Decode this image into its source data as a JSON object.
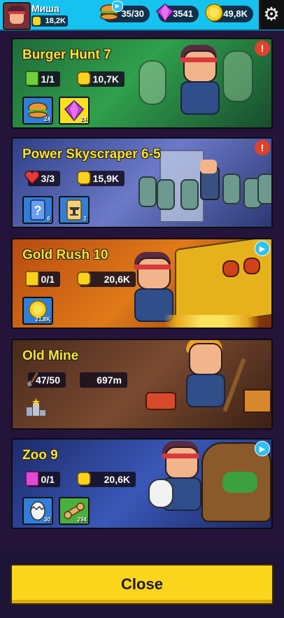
{
  "player": {
    "name": "Миша",
    "power": "18,2K"
  },
  "resources": {
    "burgers": "35/30",
    "gems": "3541",
    "coins": "49,8K"
  },
  "missions": [
    {
      "title": "Burger Hunt 7",
      "stat1": "1/1",
      "stat2": "10,7K",
      "reward1_count": "24",
      "reward2_count": "24",
      "badge": "!"
    },
    {
      "title": "Power Skyscraper 6-5",
      "stat1": "3/3",
      "stat2": "15,9K",
      "reward1_count": "6",
      "reward2_count": "1",
      "badge": "!"
    },
    {
      "title": "Gold Rush 10",
      "stat1": "0/1",
      "stat2": "20,6K",
      "reward1_count": "21,8K",
      "badge": "▶"
    },
    {
      "title": "Old Mine",
      "stat1": "47/50",
      "stat2": "697m"
    },
    {
      "title": "Zoo 9",
      "stat1": "0/1",
      "stat2": "20,6K",
      "reward1_count": "30",
      "reward2_count": "294",
      "badge": "▶"
    }
  ],
  "close_label": "Close",
  "colors": {
    "topbar": "#16c3f0",
    "title": "#fbe232",
    "close": "#fbd51c",
    "alert": "#e2402b",
    "play": "#2ec1f0"
  }
}
